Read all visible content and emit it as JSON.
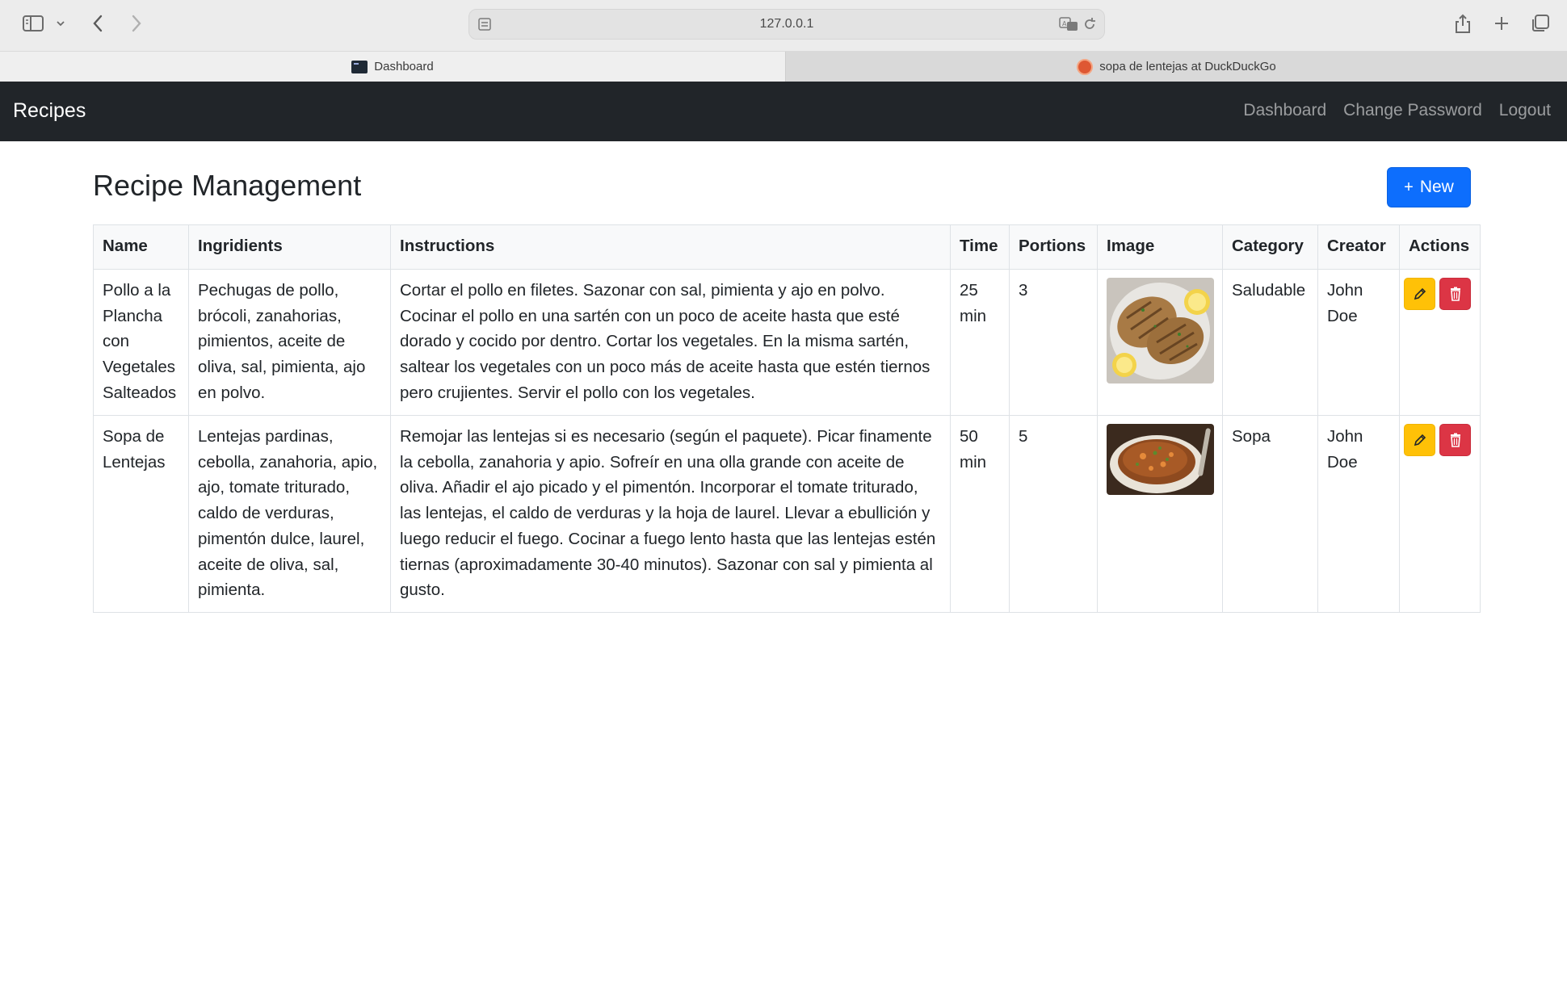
{
  "browser": {
    "url": "127.0.0.1",
    "tabs": [
      {
        "title": "Dashboard",
        "active": true
      },
      {
        "title": "sopa de lentejas at DuckDuckGo",
        "active": false
      }
    ],
    "icons": [
      "sidebar-icon",
      "chevron-down-icon",
      "back-icon",
      "forward-icon",
      "reader-icon",
      "translate-icon",
      "reload-icon",
      "share-icon",
      "plus-icon",
      "tabs-overview-icon"
    ]
  },
  "navbar": {
    "brand": "Recipes",
    "links": [
      "Dashboard",
      "Change Password",
      "Logout"
    ]
  },
  "page": {
    "title": "Recipe Management",
    "new_button": "New"
  },
  "table": {
    "headers": [
      "Name",
      "Ingridients",
      "Instructions",
      "Time",
      "Portions",
      "Image",
      "Category",
      "Creator",
      "Actions"
    ],
    "rows": [
      {
        "name": "Pollo a la Plancha con Vegetales Salteados",
        "ingredients": "Pechugas de pollo, brócoli, zanahorias, pimientos, aceite de oliva, sal, pimienta, ajo en polvo.",
        "instructions": "Cortar el pollo en filetes. Sazonar con sal, pimienta y ajo en polvo. Cocinar el pollo en una sartén con un poco de aceite hasta que esté dorado y cocido por dentro. Cortar los vegetales. En la misma sartén, saltear los vegetales con un poco más de aceite hasta que estén tiernos pero crujientes. Servir el pollo con los vegetales.",
        "time": "25 min",
        "portions": "3",
        "image": "grilled-chicken-photo",
        "category": "Saludable",
        "creator": "John Doe"
      },
      {
        "name": "Sopa de Lentejas",
        "ingredients": "Lentejas pardinas, cebolla, zanahoria, apio, ajo, tomate triturado, caldo de verduras, pimentón dulce, laurel, aceite de oliva, sal, pimienta.",
        "instructions": "Remojar las lentejas si es necesario (según el paquete). Picar finamente la cebolla, zanahoria y apio. Sofreír en una olla grande con aceite de oliva. Añadir el ajo picado y el pimentón. Incorporar el tomate triturado, las lentejas, el caldo de verduras y la hoja de laurel. Llevar a ebullición y luego reducir el fuego. Cocinar a fuego lento hasta que las lentejas estén tiernas (aproximadamente 30-40 minutos). Sazonar con sal y pimienta al gusto.",
        "time": "50 min",
        "portions": "5",
        "image": "lentil-soup-photo",
        "category": "Sopa",
        "creator": "John Doe"
      }
    ]
  },
  "colors": {
    "navbar_bg": "#212529",
    "primary": "#0d6efd",
    "warning": "#ffc107",
    "danger": "#dc3545"
  }
}
